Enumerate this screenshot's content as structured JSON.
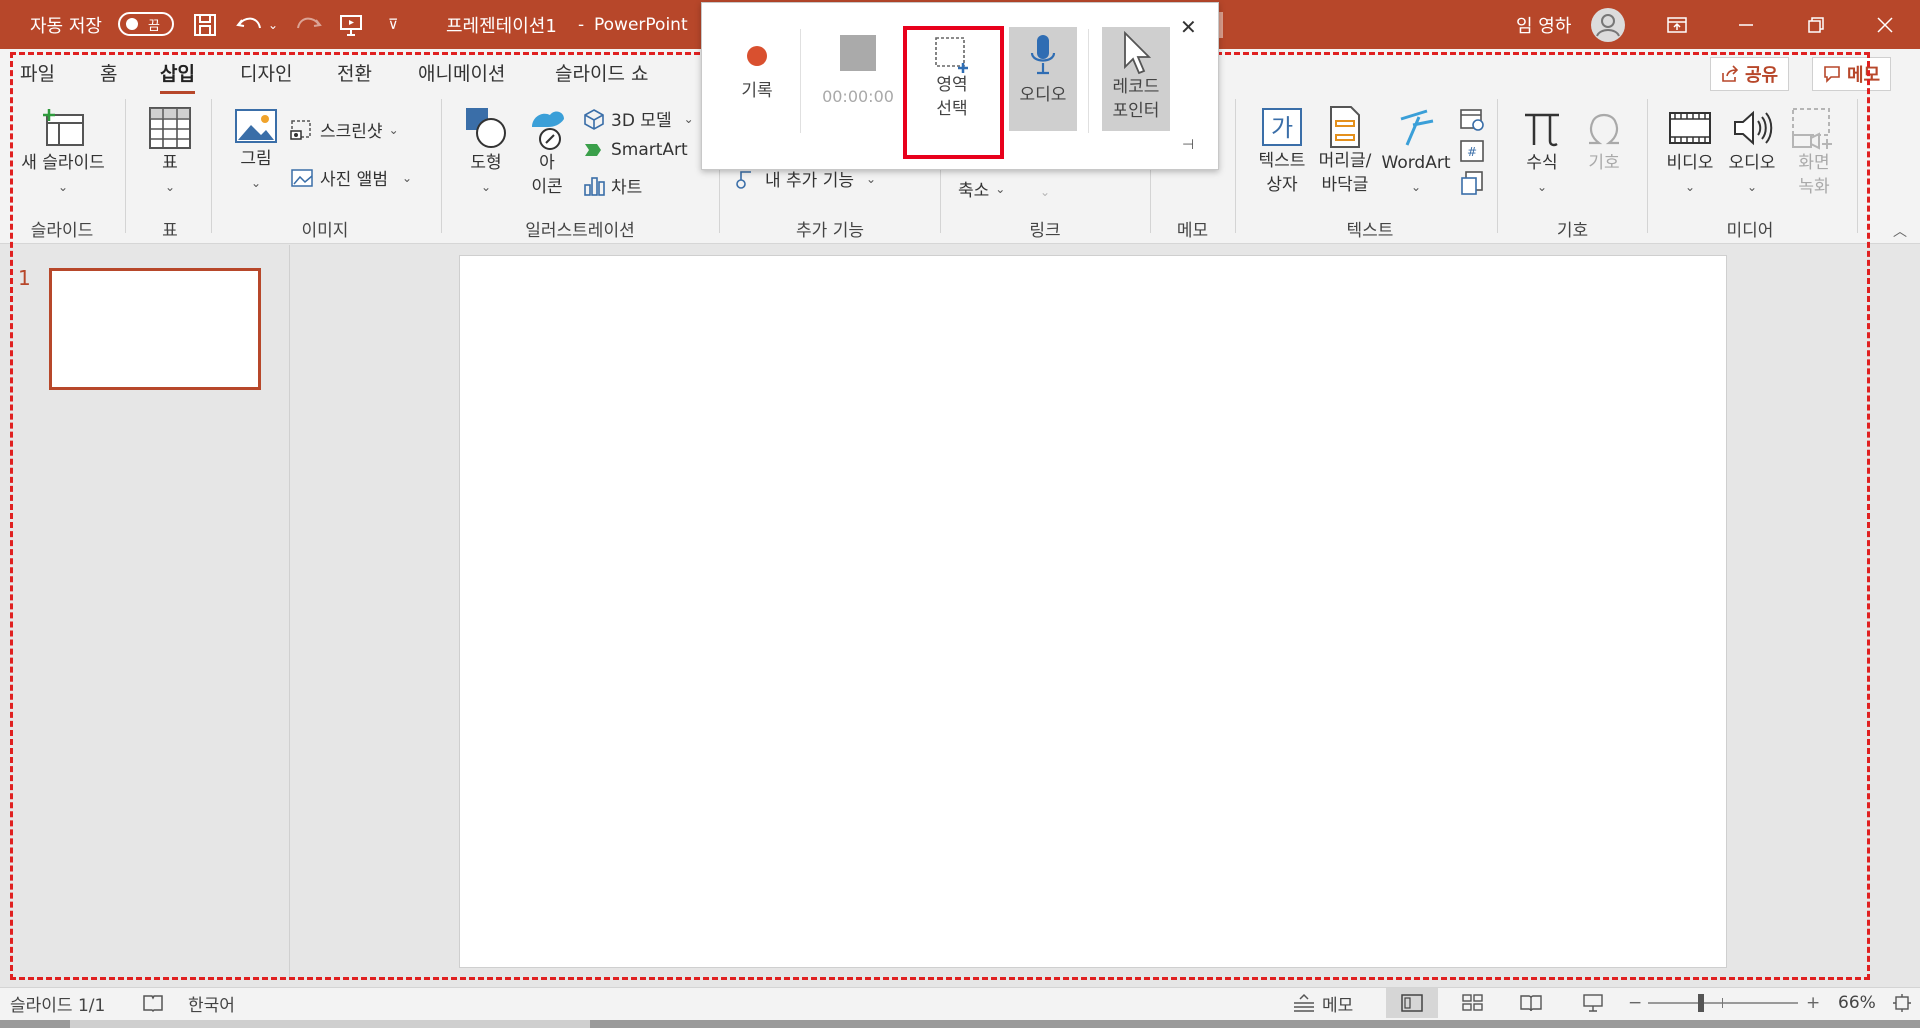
{
  "titlebar": {
    "autosave_label": "자동 저장",
    "autosave_state": "끔",
    "doc_title": "프레젠테이션1",
    "app_name": "PowerPoint",
    "user_name": "임 영하",
    "accent_color": "#b7472a"
  },
  "ribbon": {
    "tabs": [
      "파일",
      "홈",
      "삽입",
      "디자인",
      "전환",
      "애니메이션",
      "슬라이드 쇼"
    ],
    "active_tab": "삽입",
    "share_label": "공유",
    "comment_label": "메모",
    "groups": {
      "slides": {
        "label": "슬라이드",
        "new_slide": "새 슬라이드"
      },
      "table": {
        "label": "표",
        "table": "표"
      },
      "images": {
        "label": "이미지",
        "picture": "그림",
        "screenshot": "스크린샷",
        "photo_album": "사진 앨범"
      },
      "illustrations": {
        "label": "일러스트레이션",
        "shapes": "도형",
        "icons_top": "아",
        "icons_bottom": "이콘",
        "model3d": "3D 모델",
        "smartart": "SmartArt",
        "chart": "차트"
      },
      "addins": {
        "label": "추가 기능",
        "my_addins": "내 추가 기능"
      },
      "links": {
        "label": "링크",
        "zoom": "축소"
      },
      "comments": {
        "label": "메모"
      },
      "text": {
        "label": "텍스트",
        "textbox_top": "텍스트",
        "textbox_bottom": "상자",
        "header_top": "머리글/",
        "header_bottom": "바닥글",
        "wordart": "WordArt"
      },
      "symbols": {
        "label": "기호",
        "equation": "수식",
        "symbol": "기호"
      },
      "media": {
        "label": "미디어",
        "video": "비디오",
        "audio": "오디오",
        "screen_rec_top": "화면",
        "screen_rec_bottom": "녹화"
      }
    }
  },
  "recorder": {
    "record": "기록",
    "timer": "00:00:00",
    "select_area_top": "영역",
    "select_area_bottom": "선택",
    "audio": "오디오",
    "record_pointer_top": "레코드",
    "record_pointer_bottom": "포인터"
  },
  "slides_pane": {
    "slide_number": "1"
  },
  "statusbar": {
    "slide_info": "슬라이드 1/1",
    "language": "한국어",
    "notes": "메모",
    "zoom": "66%"
  }
}
